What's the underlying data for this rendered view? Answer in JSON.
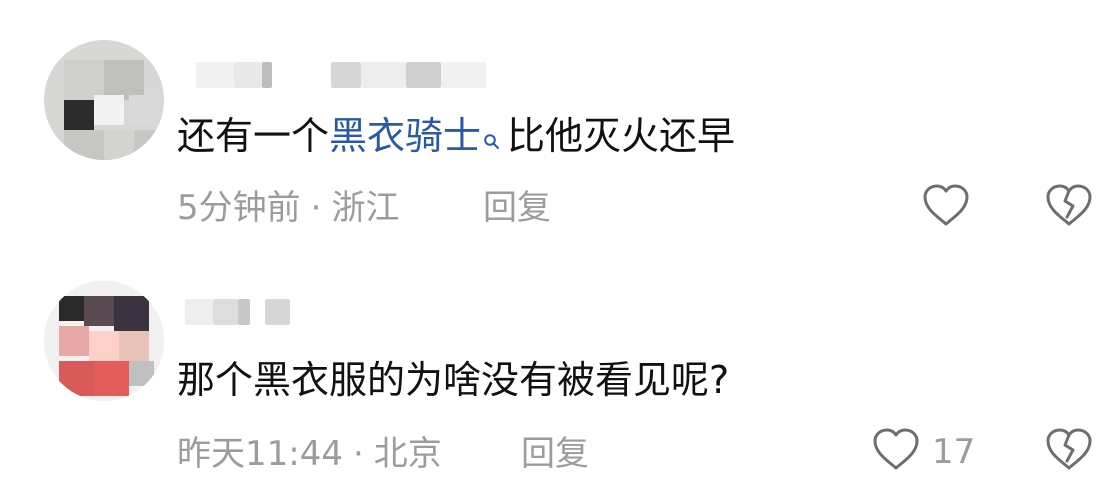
{
  "comments": [
    {
      "avatar": "blurred-avatar",
      "username": "",
      "text_before": "还有一个",
      "link_text": "黑衣骑士",
      "text_after": "比他灭火还早",
      "time": "5分钟前",
      "separator": "·",
      "location": "浙江",
      "reply_label": "回复",
      "like_count": "",
      "icons": {
        "search": "search-icon",
        "like": "heart-icon",
        "dislike": "broken-heart-icon"
      }
    },
    {
      "avatar": "blurred-avatar",
      "username": "",
      "text": "那个黑衣服的为啥没有被看见呢?",
      "time": "昨天11:44",
      "separator": "·",
      "location": "北京",
      "reply_label": "回复",
      "like_count": "17",
      "icons": {
        "like": "heart-icon",
        "dislike": "broken-heart-icon"
      }
    }
  ],
  "colors": {
    "text": "#111111",
    "meta": "#9c9c9c",
    "link": "#2a5aa6",
    "icon": "#6e6e6e"
  }
}
